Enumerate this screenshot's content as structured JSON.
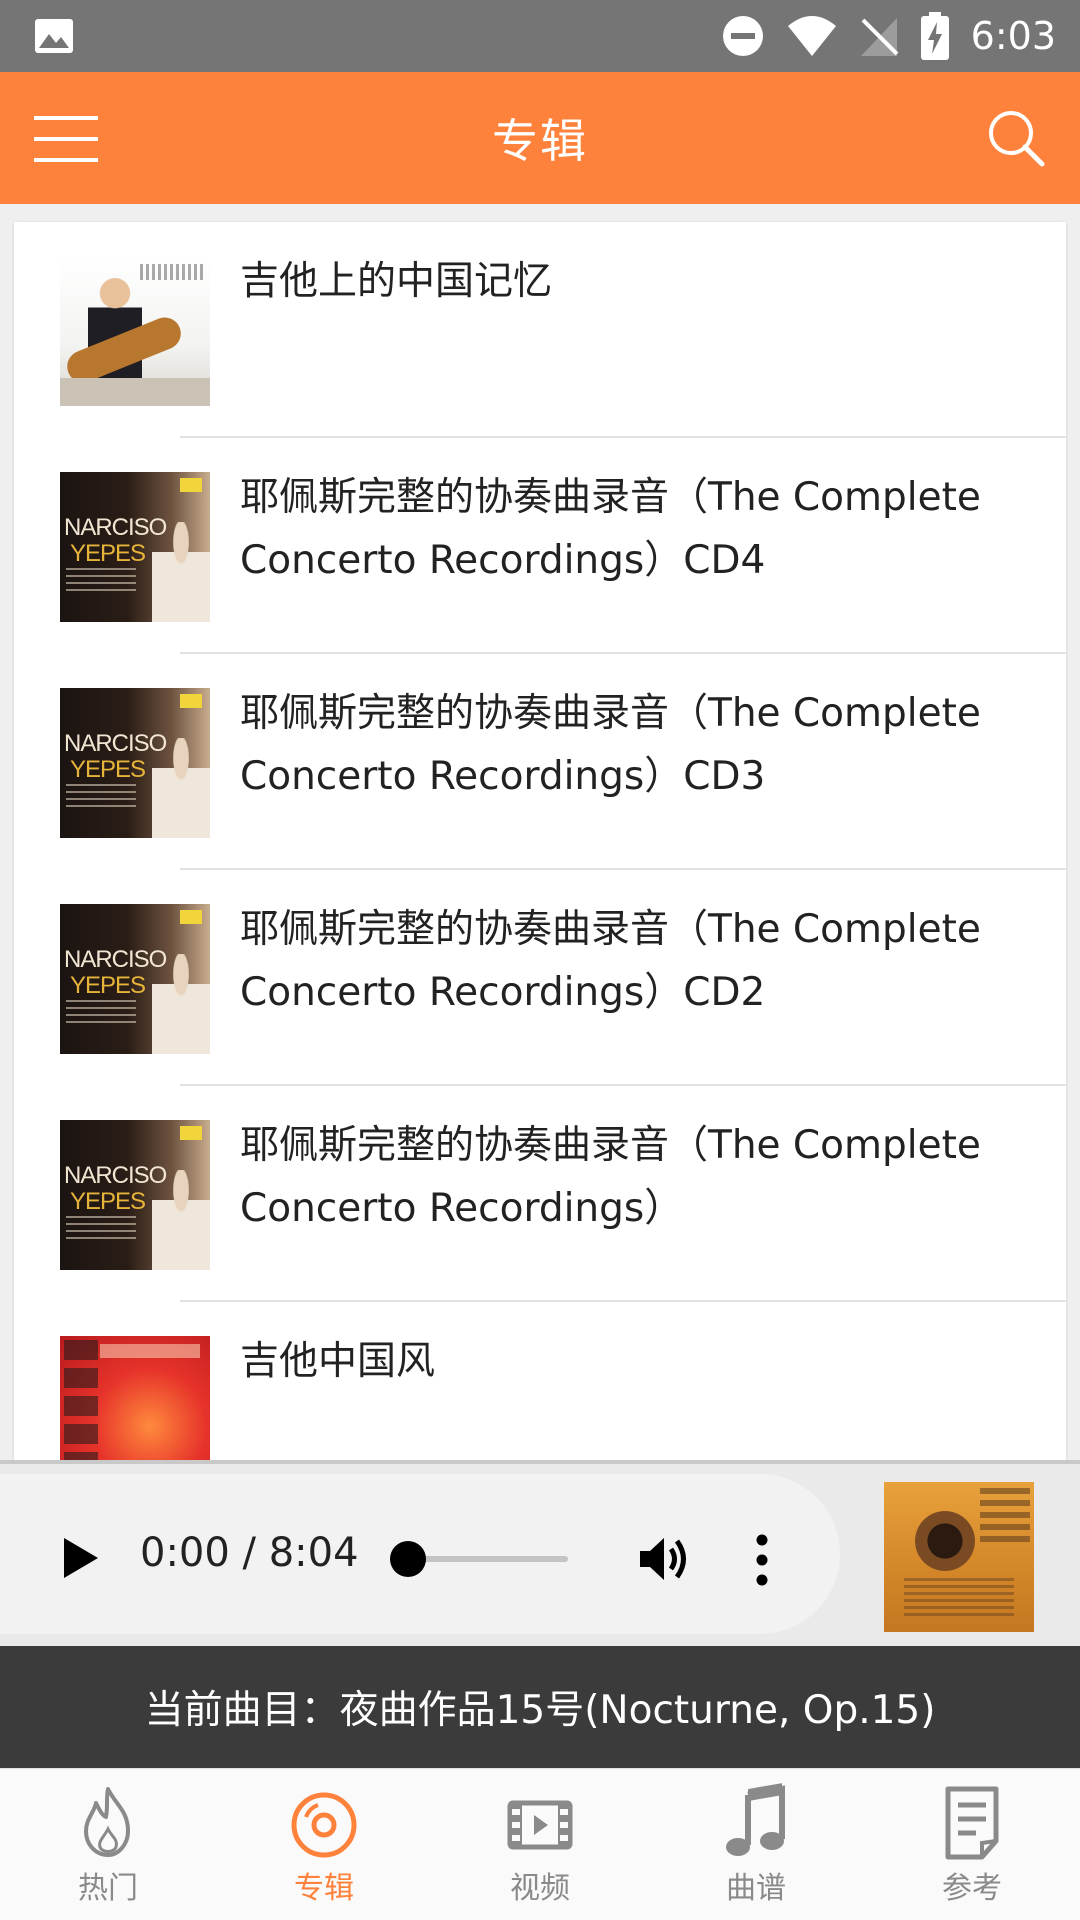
{
  "status_bar": {
    "time": "6:03",
    "icons": [
      "image-icon",
      "do-not-disturb-icon",
      "wifi-icon",
      "no-signal-icon",
      "battery-charging-icon"
    ]
  },
  "app_bar": {
    "title": "专辑",
    "menu_icon": "hamburger-menu-icon",
    "search_icon": "search-icon"
  },
  "albums": [
    {
      "title": "吉他上的中国记忆",
      "cover": "memory"
    },
    {
      "title": "耶佩斯完整的协奏曲录音（The Complete Concerto Recordings）CD4",
      "cover": "yepes"
    },
    {
      "title": "耶佩斯完整的协奏曲录音（The Complete Concerto Recordings）CD3",
      "cover": "yepes"
    },
    {
      "title": "耶佩斯完整的协奏曲录音（The Complete Concerto Recordings）CD2",
      "cover": "yepes"
    },
    {
      "title": "耶佩斯完整的协奏曲录音（The Complete Concerto Recordings）",
      "cover": "yepes"
    },
    {
      "title": "吉他中国风",
      "cover": "china"
    }
  ],
  "covers": {
    "yepes_line1": "NARCISO",
    "yepes_line2": "YEPES"
  },
  "player": {
    "time": "0:00 / 8:04",
    "progress": 0
  },
  "now_playing": {
    "text": "当前曲目：夜曲作品15号(Nocturne, Op.15)"
  },
  "bottom_nav": [
    {
      "label": "热门",
      "icon": "flame-icon",
      "active": false
    },
    {
      "label": "专辑",
      "icon": "disc-icon",
      "active": true
    },
    {
      "label": "视频",
      "icon": "film-icon",
      "active": false
    },
    {
      "label": "曲谱",
      "icon": "music-note-icon",
      "active": false
    },
    {
      "label": "参考",
      "icon": "document-icon",
      "active": false
    }
  ],
  "colors": {
    "accent": "#ff823c",
    "status_bar": "#757575",
    "now_playing_bg": "#3b3b3b",
    "inactive": "#8a8a8a"
  }
}
